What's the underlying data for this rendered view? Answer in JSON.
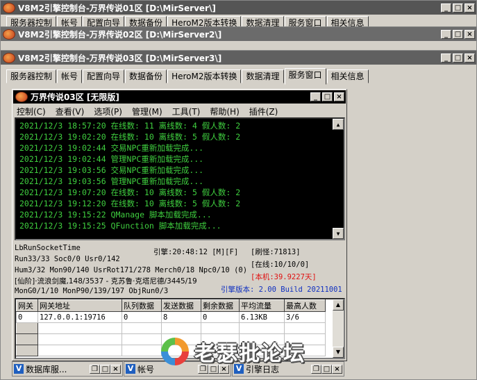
{
  "windows": [
    {
      "title": "V8M2引擎控制台-万界传说01区 [D:\\MirServer\\]"
    },
    {
      "title": "V8M2引擎控制台-万界传说02区 [D:\\MirServer2\\]"
    },
    {
      "title": "V8M2引擎控制台-万界传说03区 [D:\\MirServer3\\]"
    }
  ],
  "partial_tabs_1": [
    "服务器控制",
    "帐号",
    "配置向导",
    "数据备份",
    "HeroM2版本转换",
    "数据清理",
    "服务窗口",
    "相关信息"
  ],
  "tabs": [
    "服务器控制",
    "帐号",
    "配置向导",
    "数据备份",
    "HeroM2版本转换",
    "数据清理",
    "服务窗口",
    "相关信息"
  ],
  "active_tab": "服务窗口",
  "inner": {
    "title": "万界传说03区 [无限版]",
    "menu": [
      "控制(C)",
      "查看(V)",
      "选项(P)",
      "管理(M)",
      "工具(T)",
      "帮助(H)",
      "插件(Z)"
    ]
  },
  "log_lines": [
    "2021/12/3 18:57:20 在线数: 11 离线数: 4 假人数: 2",
    "2021/12/3 19:02:20 在线数: 10 离线数: 5 假人数: 2",
    "2021/12/3 19:02:44 交易NPC重新加载完成...",
    "2021/12/3 19:02:44 管理NPC重新加载完成...",
    "2021/12/3 19:03:56 交易NPC重新加载完成...",
    "2021/12/3 19:03:56 管理NPC重新加载完成...",
    "2021/12/3 19:07:20 在线数: 10 离线数: 5 假人数: 2",
    "2021/12/3 19:12:20 在线数: 10 离线数: 5 假人数: 2",
    "2021/12/3 19:15:22 QManage 脚本加载完成...",
    "2021/12/3 19:15:25 QFunction 脚本加载完成..."
  ],
  "stats": {
    "socket_time": "LbRunSocketTime",
    "engine_time": "引擎:20:48:12 [M][F]",
    "refresh": "[刷怪:71813]",
    "run_line": "Run33/33 Soc0/0 Usr0/142",
    "online": "[在线:10/10/0]",
    "hum_line": "Hum3/32 Mon90/140 UsrRot171/278 Merch0/18 Npc0/10 (0)",
    "machine": "[本机:39.9227天]",
    "location": "[仙阶]·流浪剑魔,148/3537 - 克苏鲁·克塔尼德/3445/19",
    "mon_line": "MonG0/1/10 MonP90/139/197 ObjRun0/3",
    "version": "引擎版本: 2.00 Build 20211001"
  },
  "grid": {
    "headers": [
      "网关",
      "网关地址",
      "队列数据",
      "发送数据",
      "剩余数据",
      "平均流量",
      "最高人数"
    ],
    "rows": [
      [
        "0",
        "127.0.0.1:19716",
        "0",
        "8",
        "0",
        "6.13KB",
        "3/6"
      ]
    ]
  },
  "taskbar": [
    {
      "label": "数据库服..."
    },
    {
      "label": "帐号"
    },
    {
      "label": "引擎日志"
    }
  ],
  "watermark": "老瑟批论坛",
  "colors": {
    "log_text": "#3fcf3f",
    "machine_red": "#e01010",
    "version_blue": "#1030c0"
  }
}
